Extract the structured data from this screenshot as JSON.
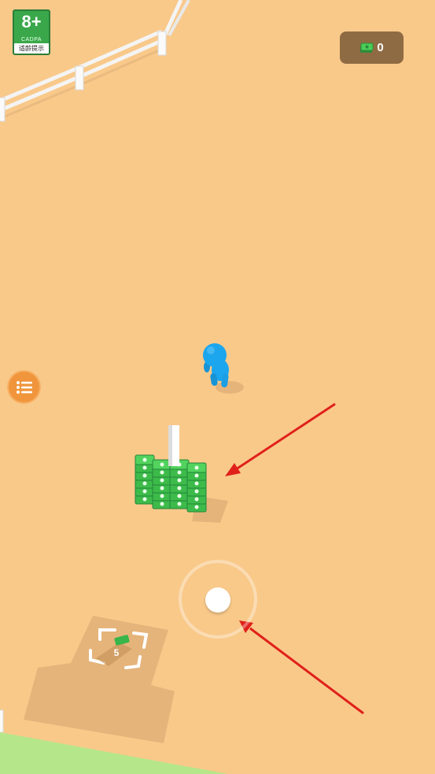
{
  "age_rating": {
    "label": "8+",
    "org": "CADPA",
    "tip": "适龄提示"
  },
  "currency": {
    "icon": "cash-icon",
    "amount": "0"
  },
  "menu": {
    "icon": "list-menu-icon"
  },
  "build_plot": {
    "cost": "5",
    "icon": "cash-icon"
  },
  "colors": {
    "ground": "#f9c98a",
    "grass": "#b6e68a",
    "player": "#1ca6ee",
    "cash": "#3dbb4a",
    "arrow": "#e0201b",
    "menu_button": "#f0953b",
    "money_box": "#8f6b43"
  }
}
